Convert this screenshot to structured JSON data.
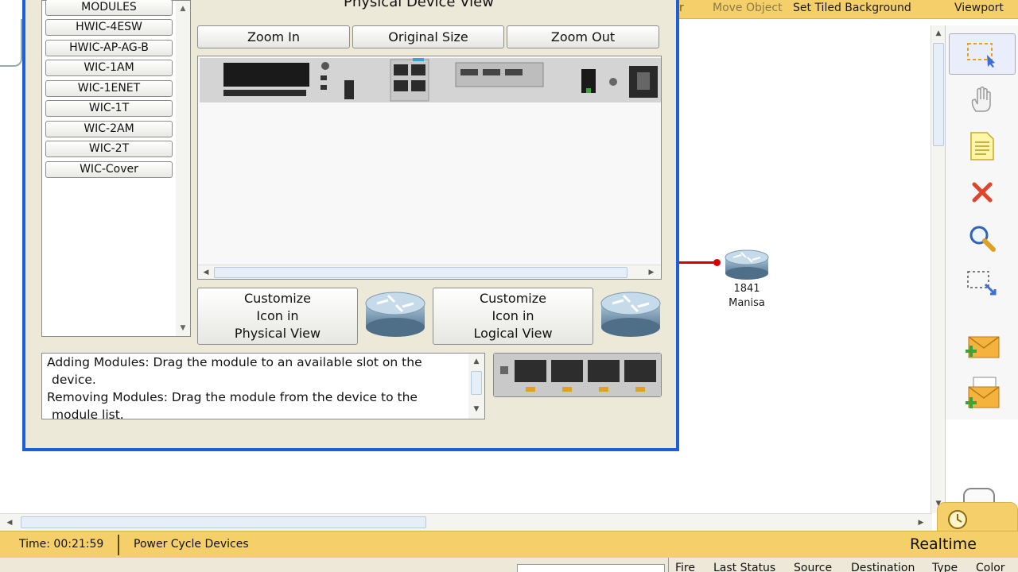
{
  "toolbar": {
    "partial": "r",
    "move_object": "Move Object",
    "set_tiled_background": "Set Tiled Background",
    "viewport": "Viewport"
  },
  "dialog": {
    "title": "Physical Device View",
    "modules": [
      "MODULES",
      "HWIC-4ESW",
      "HWIC-AP-AG-B",
      "WIC-1AM",
      "WIC-1ENET",
      "WIC-1T",
      "WIC-2AM",
      "WIC-2T",
      "WIC-Cover"
    ],
    "zoom_in": "Zoom In",
    "original_size": "Original Size",
    "zoom_out": "Zoom Out",
    "customize_physical": [
      "Customize",
      "Icon in",
      "Physical View"
    ],
    "customize_logical": [
      "Customize",
      "Icon in",
      "Logical View"
    ],
    "info": [
      "Adding Modules: Drag the module to an available slot on the",
      "device.",
      "Removing Modules: Drag the module from the device to the",
      "module list."
    ]
  },
  "device": {
    "model": "1841",
    "name": "Manisa"
  },
  "status": {
    "time": "Time: 00:21:59",
    "power_cycle": "Power Cycle Devices",
    "mode": "Realtime"
  },
  "event_columns": [
    "Fire",
    "Last Status",
    "Source",
    "Destination",
    "Type",
    "Color"
  ],
  "tools": [
    "select-icon",
    "hand-icon",
    "note-icon",
    "delete-icon",
    "inspect-icon",
    "resize-icon",
    "add-simple-pdu-icon",
    "add-complex-pdu-icon"
  ]
}
